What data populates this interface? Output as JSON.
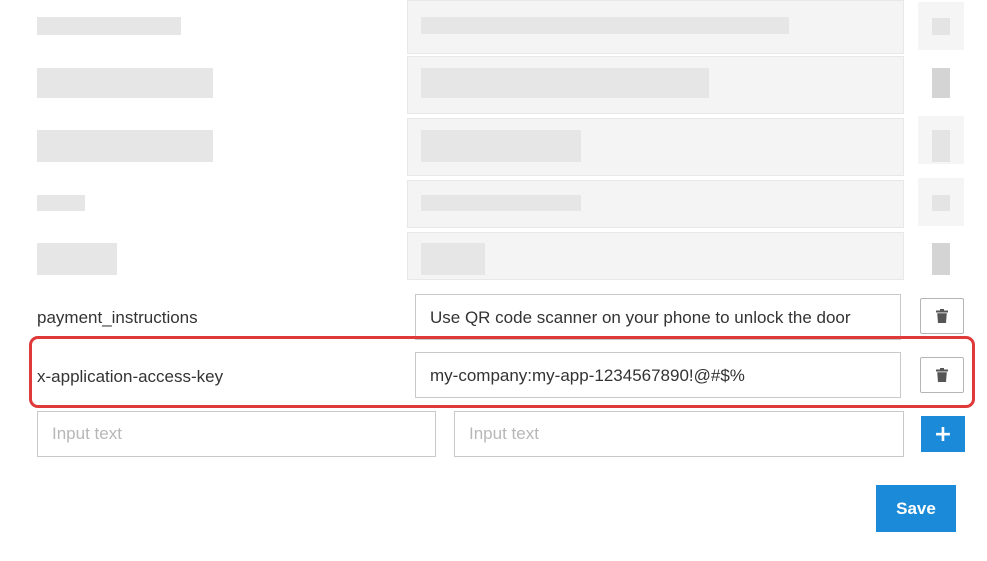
{
  "rows": [
    {
      "key": "payment_instructions",
      "value": "Use QR code scanner on your phone to unlock the door"
    },
    {
      "key": "x-application-access-key",
      "value": "my-company:my-app-1234567890!@#$%"
    }
  ],
  "new_row": {
    "key_placeholder": "Input text",
    "value_placeholder": "Input text"
  },
  "buttons": {
    "add_label": "+",
    "save_label": "Save",
    "delete_icon": "trash-icon"
  },
  "colors": {
    "primary": "#1b8ad8",
    "highlight": "#e0393a"
  }
}
